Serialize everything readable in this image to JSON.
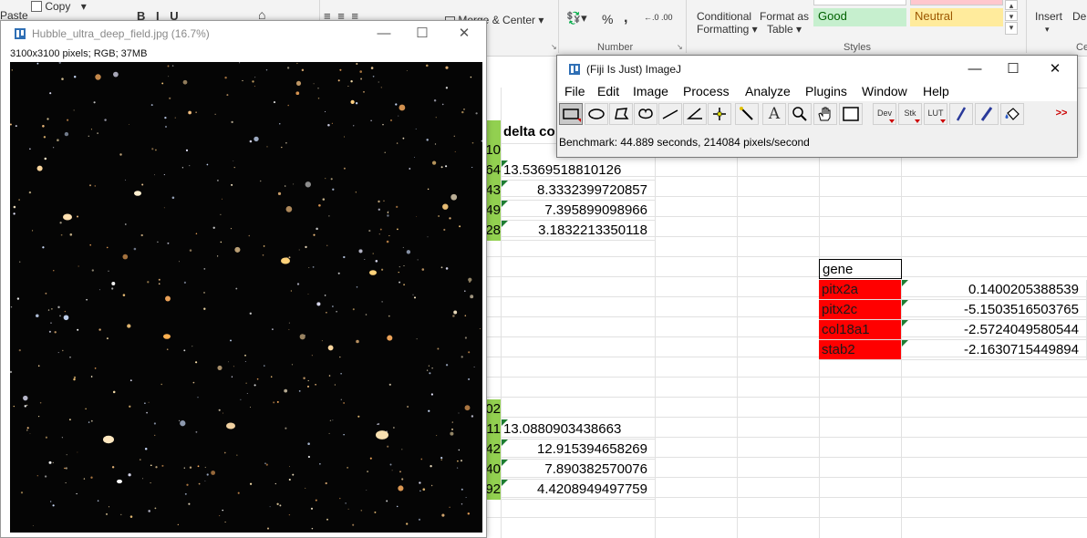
{
  "excel": {
    "ribbon": {
      "paste": "Paste",
      "copy": "Copy",
      "merge_center": "Merge & Center",
      "percent": "%",
      "comma": ",",
      "number_group": "Number",
      "conditional_formatting": "Conditional\nFormatting",
      "conditional_line1": "Conditional",
      "conditional_line2": "Formatting ▾",
      "format_as_table_line1": "Format as",
      "format_as_table_line2": "Table ▾",
      "good": "Good",
      "neutral": "Neutral",
      "styles_group": "Styles",
      "insert": "Insert",
      "delete": "Del",
      "cells_group": "Ce"
    },
    "colors": {
      "good_bg": "#c6efce",
      "good_text": "#006100",
      "neutral_bg": "#ffeb9c",
      "neutral_text": "#9c5700",
      "green_cell": "#92d050",
      "red_cell": "#ff0000"
    },
    "col_header": "delta co",
    "left_values_top": [
      "10",
      "64",
      "43",
      "49",
      "28"
    ],
    "delta_top": [
      "13.5369518810126",
      "8.3332399720857",
      "7.395899098966",
      "3.1832213350118"
    ],
    "left_values_bottom": [
      "02",
      "11",
      "42",
      "40",
      "92"
    ],
    "delta_bottom": [
      "13.0880903438663",
      "12.915394658269",
      "7.890382570076",
      "4.4208949497759"
    ],
    "gene_header": "gene",
    "genes": [
      {
        "name": "pitx2a",
        "value": "0.1400205388539"
      },
      {
        "name": "pitx2c",
        "value": "-5.1503516503765"
      },
      {
        "name": "col18a1",
        "value": "-2.5724049580544"
      },
      {
        "name": "stab2",
        "value": "-2.1630715449894"
      }
    ]
  },
  "image_window": {
    "title": "Hubble_ultra_deep_field.jpg (16.7%)",
    "info": "3100x3100 pixels; RGB; 37MB"
  },
  "imagej": {
    "title": "(Fiji Is Just) ImageJ",
    "menu": [
      "File",
      "Edit",
      "Image",
      "Process",
      "Analyze",
      "Plugins",
      "Window",
      "Help"
    ],
    "tools": [
      "rectangle",
      "oval",
      "polygon",
      "freehand",
      "line",
      "angle",
      "point",
      "wand",
      "text",
      "zoom",
      "hand",
      "color-picker",
      "Dev",
      "Stk",
      "LUT",
      "pencil",
      "brush",
      "flood-fill",
      "more"
    ],
    "tool_labels": {
      "dev": "Dev",
      "stk": "Stk",
      "lut": "LUT",
      "more": ">>",
      "text": "A"
    },
    "status": "Benchmark: 44.889 seconds, 214084 pixels/second"
  }
}
